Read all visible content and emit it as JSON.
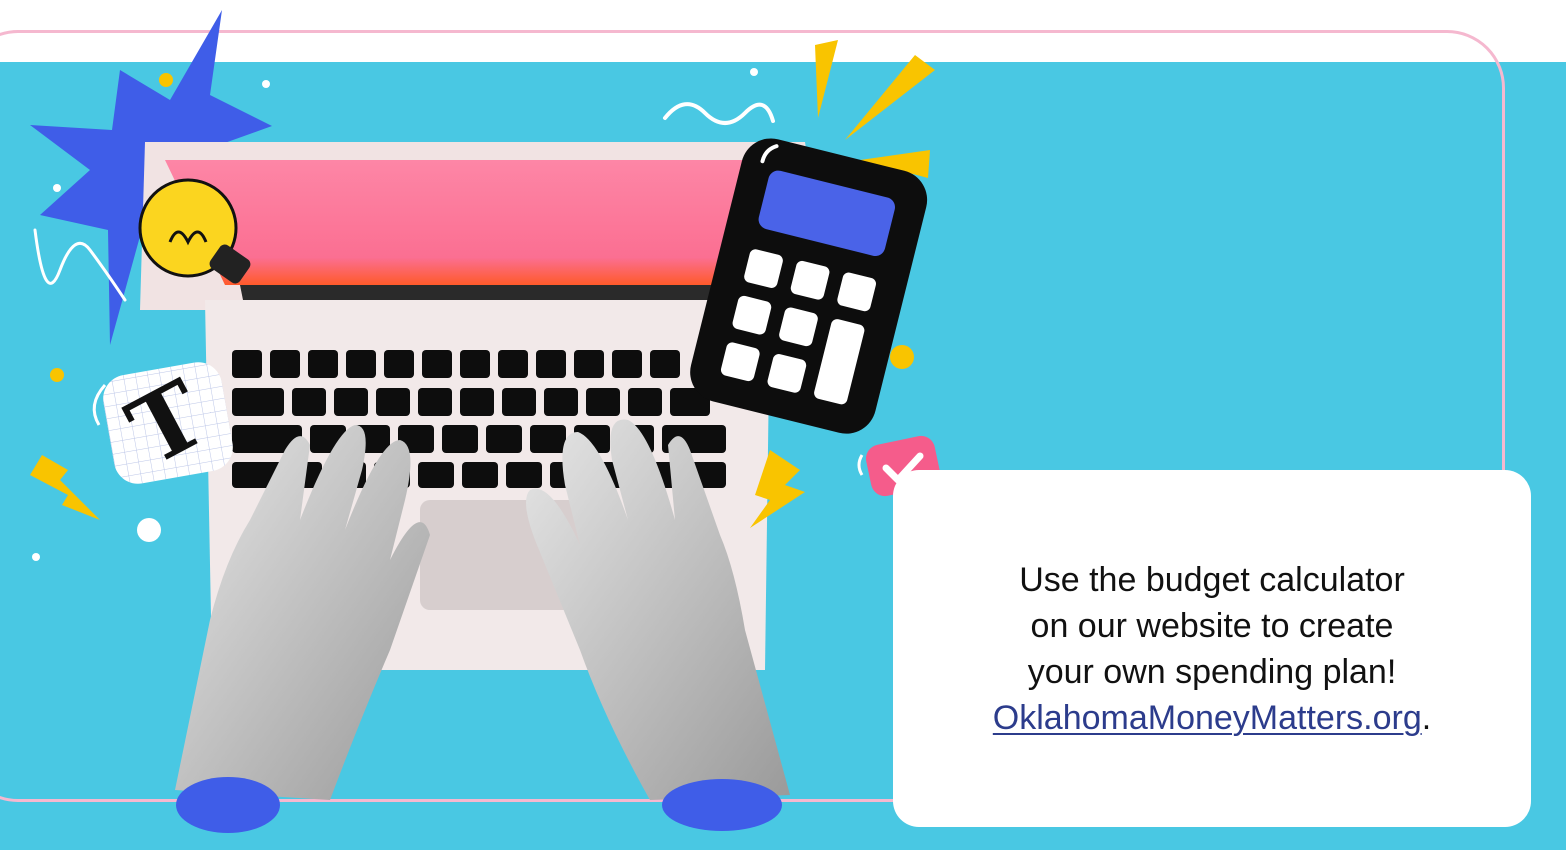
{
  "card": {
    "lines": [
      "Use the budget calculator",
      "on our website to create",
      "your own spending plan!"
    ],
    "link_text": "OklahomaMoneyMatters.org",
    "trailing": "."
  },
  "illustration": {
    "badge_letter": "T"
  },
  "colors": {
    "background": "#49c8e3",
    "frame": "#f5b8cf",
    "screen": "#fb7fa3",
    "calculator_display": "#4a63e8",
    "cuffs": "#4a63e8",
    "accent_yellow": "#f9c400",
    "link": "#2c3c8c"
  },
  "icons": [
    "lightbulb-icon",
    "calculator-icon",
    "checkmark-badge-icon",
    "lightning-bolt-icon",
    "starburst-icon",
    "letter-t-badge-icon"
  ]
}
